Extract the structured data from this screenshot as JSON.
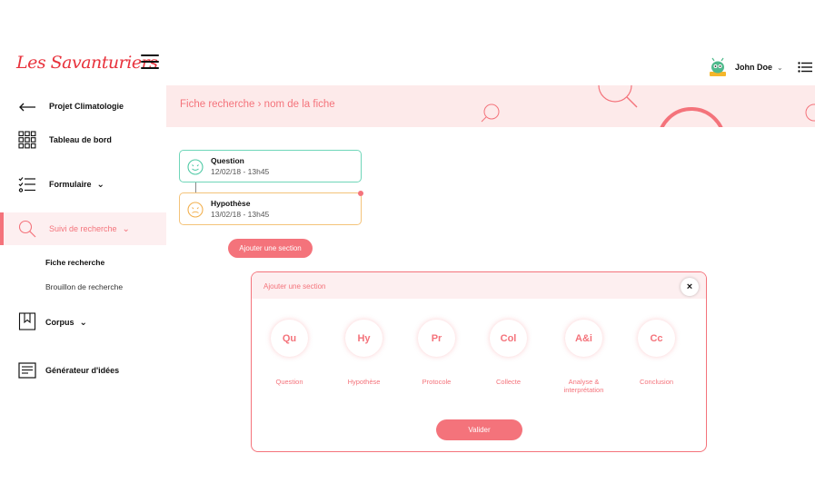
{
  "header": {
    "logo": "Les Savanturiers",
    "user_name": "John Doe",
    "user_caret": "⌄"
  },
  "sidebar": {
    "project": "Projet Climatologie",
    "dashboard": "Tableau de bord",
    "form": "Formulaire",
    "research": "Suivi de recherche",
    "sub_items": [
      "Fiche recherche",
      "Brouillon de recherche"
    ],
    "corpus": "Corpus",
    "ideas": "Générateur d'idées"
  },
  "breadcrumb": "Fiche recherche › nom de la fiche",
  "timeline": [
    {
      "title": "Question",
      "date": "12/02/18 - 13h45"
    },
    {
      "title": "Hypothèse",
      "date": "13/02/18 - 13h45"
    }
  ],
  "add_section_button": "Ajouter une section",
  "modal": {
    "title": "Ajouter une section",
    "close": "×",
    "options": [
      {
        "abbr": "Qu",
        "label": "Question"
      },
      {
        "abbr": "Hy",
        "label": "Hypothèse"
      },
      {
        "abbr": "Pr",
        "label": "Protocole"
      },
      {
        "abbr": "Col",
        "label": "Collecte"
      },
      {
        "abbr": "A&i",
        "label": "Analyse & interprétation"
      },
      {
        "abbr": "Cc",
        "label": "Conclusion"
      }
    ],
    "submit": "Valider"
  },
  "colors": {
    "accent": "#f4737b",
    "accent_light": "#fdeaea",
    "question_border": "#6fd6b9",
    "hypothesis_border": "#f4c37a"
  }
}
